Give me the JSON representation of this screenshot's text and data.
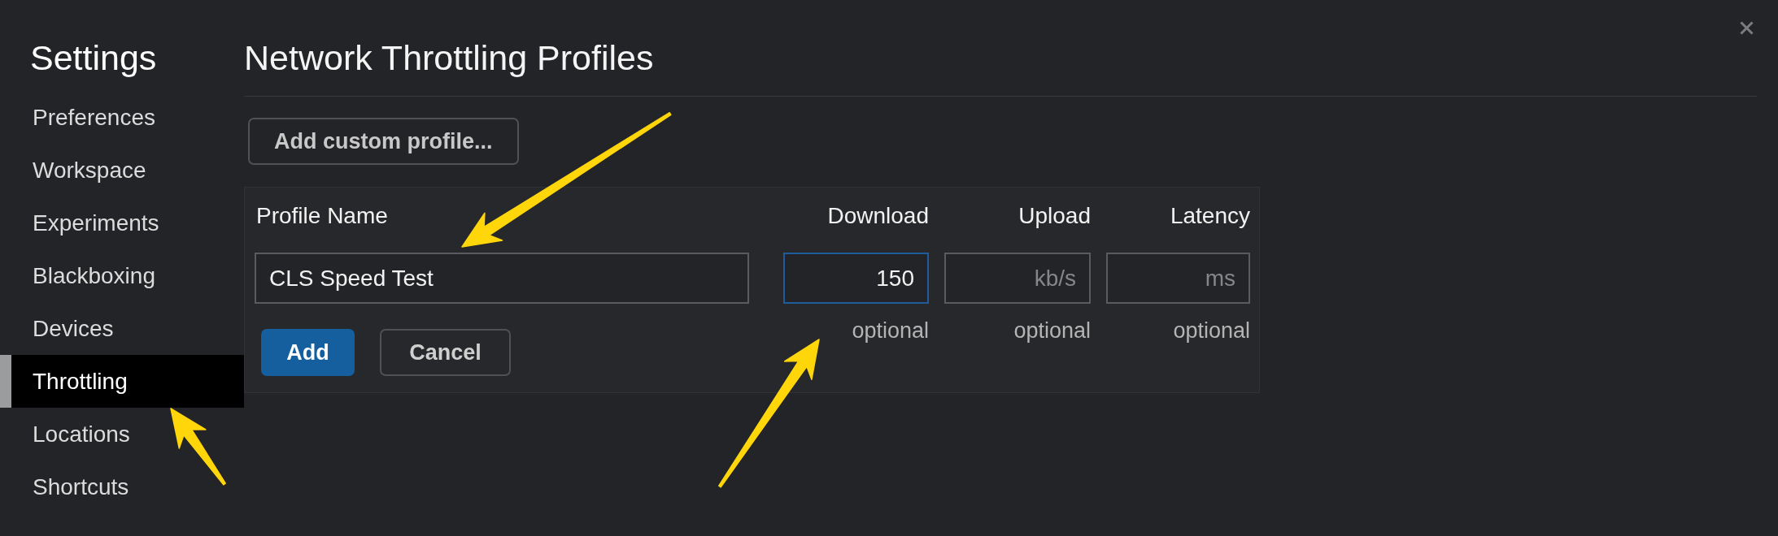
{
  "sidebar": {
    "title": "Settings",
    "items": [
      {
        "label": "Preferences",
        "selected": false
      },
      {
        "label": "Workspace",
        "selected": false
      },
      {
        "label": "Experiments",
        "selected": false
      },
      {
        "label": "Blackboxing",
        "selected": false
      },
      {
        "label": "Devices",
        "selected": false
      },
      {
        "label": "Throttling",
        "selected": true
      },
      {
        "label": "Locations",
        "selected": false
      },
      {
        "label": "Shortcuts",
        "selected": false
      }
    ]
  },
  "main": {
    "title": "Network Throttling Profiles",
    "add_profile_button": "Add custom profile...",
    "form": {
      "columns": [
        {
          "label": "Profile Name"
        },
        {
          "label": "Download"
        },
        {
          "label": "Upload"
        },
        {
          "label": "Latency"
        }
      ],
      "name_field": {
        "value": "CLS Speed Test",
        "focused": false
      },
      "rate_fields": [
        {
          "value": "150",
          "focused": true,
          "hint": "optional"
        },
        {
          "placeholder": "kb/s",
          "focused": false,
          "hint": "optional"
        },
        {
          "placeholder": "ms",
          "focused": false,
          "hint": "optional"
        }
      ],
      "buttons": [
        {
          "label": "Add",
          "kind": "primary"
        },
        {
          "label": "Cancel",
          "kind": "secondary"
        }
      ]
    }
  }
}
